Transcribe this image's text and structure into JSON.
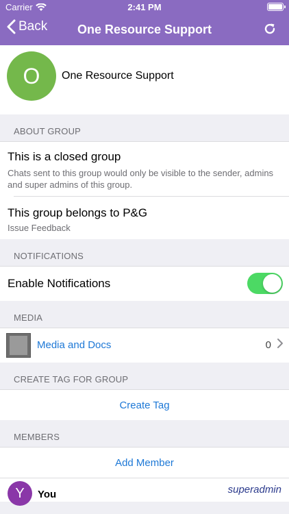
{
  "status_bar": {
    "carrier": "Carrier",
    "time": "2:41 PM"
  },
  "nav": {
    "back_label": "Back",
    "title": "One Resource Support"
  },
  "group": {
    "avatar_letter": "O",
    "name": "One Resource Support"
  },
  "about": {
    "header": "ABOUT GROUP",
    "closed_title": "This is a closed group",
    "closed_desc": "Chats sent to this group would only be visible to the sender, admins and super admins of this group.",
    "belongs_title": "This group belongs to P&G",
    "belongs_sub": "Issue Feedback"
  },
  "notifications": {
    "header": "NOTIFICATIONS",
    "label": "Enable Notifications",
    "enabled": true
  },
  "media": {
    "header": "MEDIA",
    "label": "Media and Docs",
    "count": "0"
  },
  "tags": {
    "header": "CREATE TAG FOR GROUP",
    "create_label": "Create Tag"
  },
  "members": {
    "header": "MEMBERS",
    "add_label": "Add Member",
    "items": [
      {
        "avatar_letter": "Y",
        "name": "You",
        "role": "superadmin"
      }
    ]
  },
  "colors": {
    "nav": "#8a6bc1",
    "accent": "#1d78d6",
    "toggle_on": "#4cd964",
    "group_avatar": "#74b84b",
    "member_avatar": "#8a37a8"
  }
}
